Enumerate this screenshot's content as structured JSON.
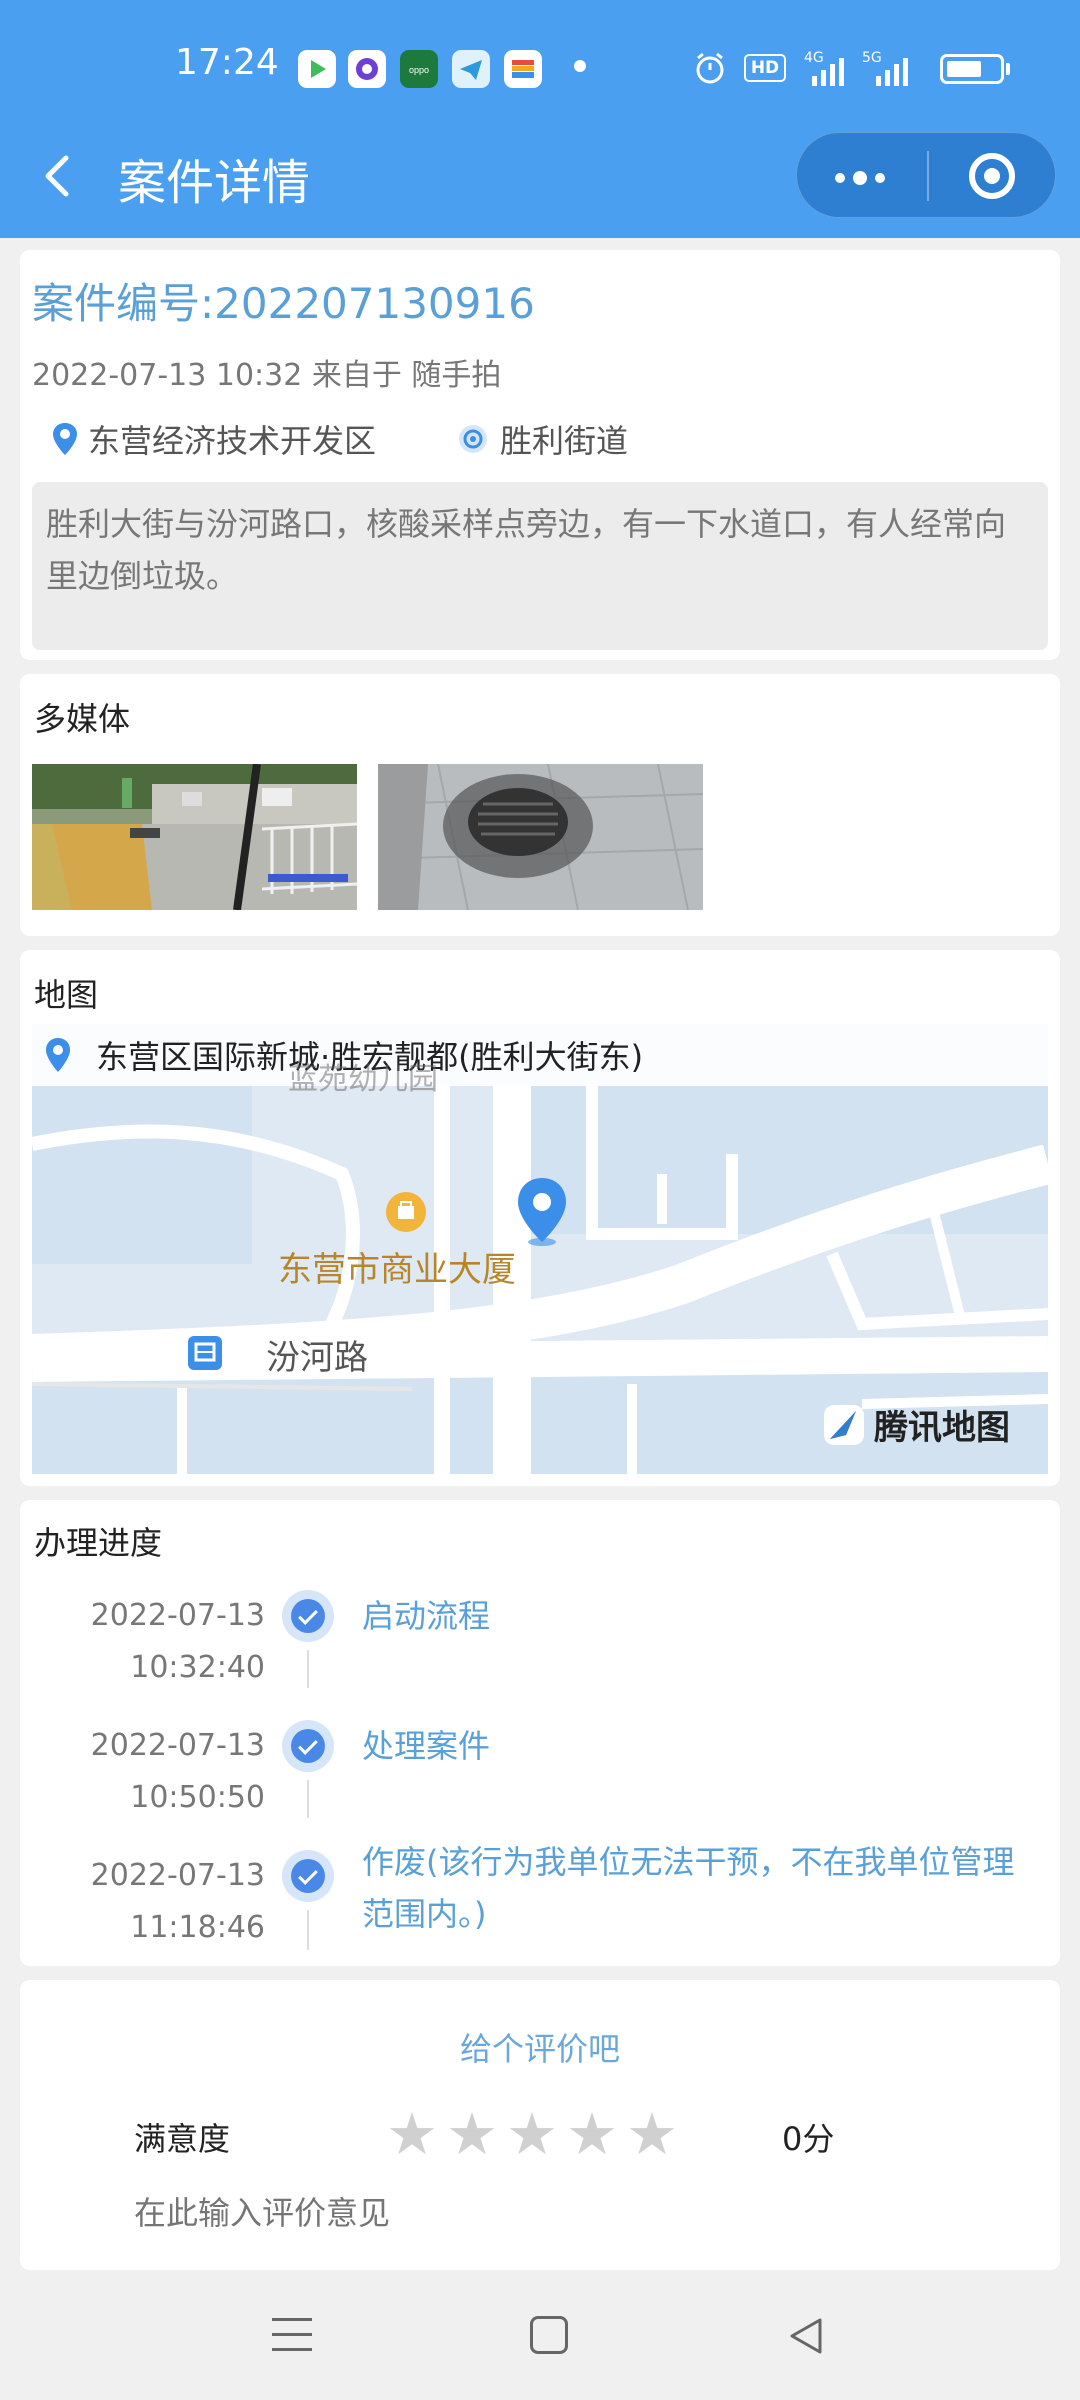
{
  "status_bar": {
    "time": "17:24",
    "net_4g": "4G",
    "net_5g": "5G",
    "hd": "HD"
  },
  "nav": {
    "title": "案件详情"
  },
  "case": {
    "number": "案件编号:202207130916",
    "meta": "2022-07-13 10:32 来自于 随手拍",
    "district": "东营经济技术开发区",
    "street": "胜利街道",
    "description": "胜利大街与汾河路口，核酸采样点旁边，有一下水道口，有人经常向里边倒垃圾。"
  },
  "media": {
    "title": "多媒体"
  },
  "map": {
    "title": "地图",
    "address": "东营区国际新城·胜宏靓都(胜利大街东)",
    "poi_top": "蓝苑幼儿园",
    "poi_mall": "东营市商业大厦",
    "road": "汾河路",
    "brand": "腾讯地图"
  },
  "progress": {
    "title": "办理进度",
    "items": [
      {
        "date": "2022-07-13",
        "time": "10:32:40",
        "label": "启动流程"
      },
      {
        "date": "2022-07-13",
        "time": "10:50:50",
        "label": "处理案件"
      },
      {
        "date": "2022-07-13",
        "time": "11:18:46",
        "label": "作废(该行为我单位无法干预，不在我单位管理范围内。)"
      }
    ]
  },
  "evaluation": {
    "title": "给个评价吧",
    "satisfaction_label": "满意度",
    "rating": 0,
    "score": "0分",
    "placeholder": "在此输入评价意见"
  },
  "colors": {
    "header": "#4a9ff0",
    "accent": "#5aa0d8",
    "timeline_dot": "#4a88e8"
  }
}
